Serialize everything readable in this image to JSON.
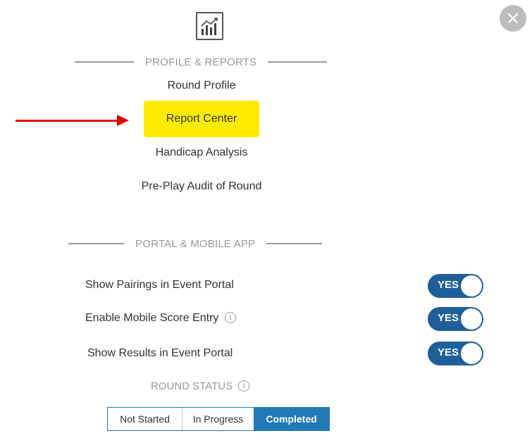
{
  "close_icon": "close-icon",
  "header_icon": "chart-report-icon",
  "profile_section": {
    "title": "PROFILE & REPORTS",
    "links": [
      {
        "label": "Round Profile"
      },
      {
        "label": "Report Center",
        "highlighted": true
      },
      {
        "label": "Handicap Analysis"
      },
      {
        "label": "Pre-Play Audit of Round"
      }
    ]
  },
  "portal_section": {
    "title": "PORTAL & MOBILE APP",
    "settings": [
      {
        "label": "Show Pairings in Event Portal",
        "toggle": "YES",
        "info": false
      },
      {
        "label": "Enable Mobile Score Entry",
        "toggle": "YES",
        "info": true
      },
      {
        "label": "Show Results in Event Portal",
        "toggle": "YES",
        "info": false
      }
    ]
  },
  "round_status": {
    "label": "ROUND STATUS",
    "info_glyph": "i",
    "options": [
      "Not Started",
      "In Progress",
      "Completed"
    ],
    "selected": "Completed"
  },
  "colors": {
    "toggle_on": "#1f5f99",
    "segment_active": "#1f7ab6",
    "highlight": "#ffeb00",
    "arrow": "#e60000"
  }
}
